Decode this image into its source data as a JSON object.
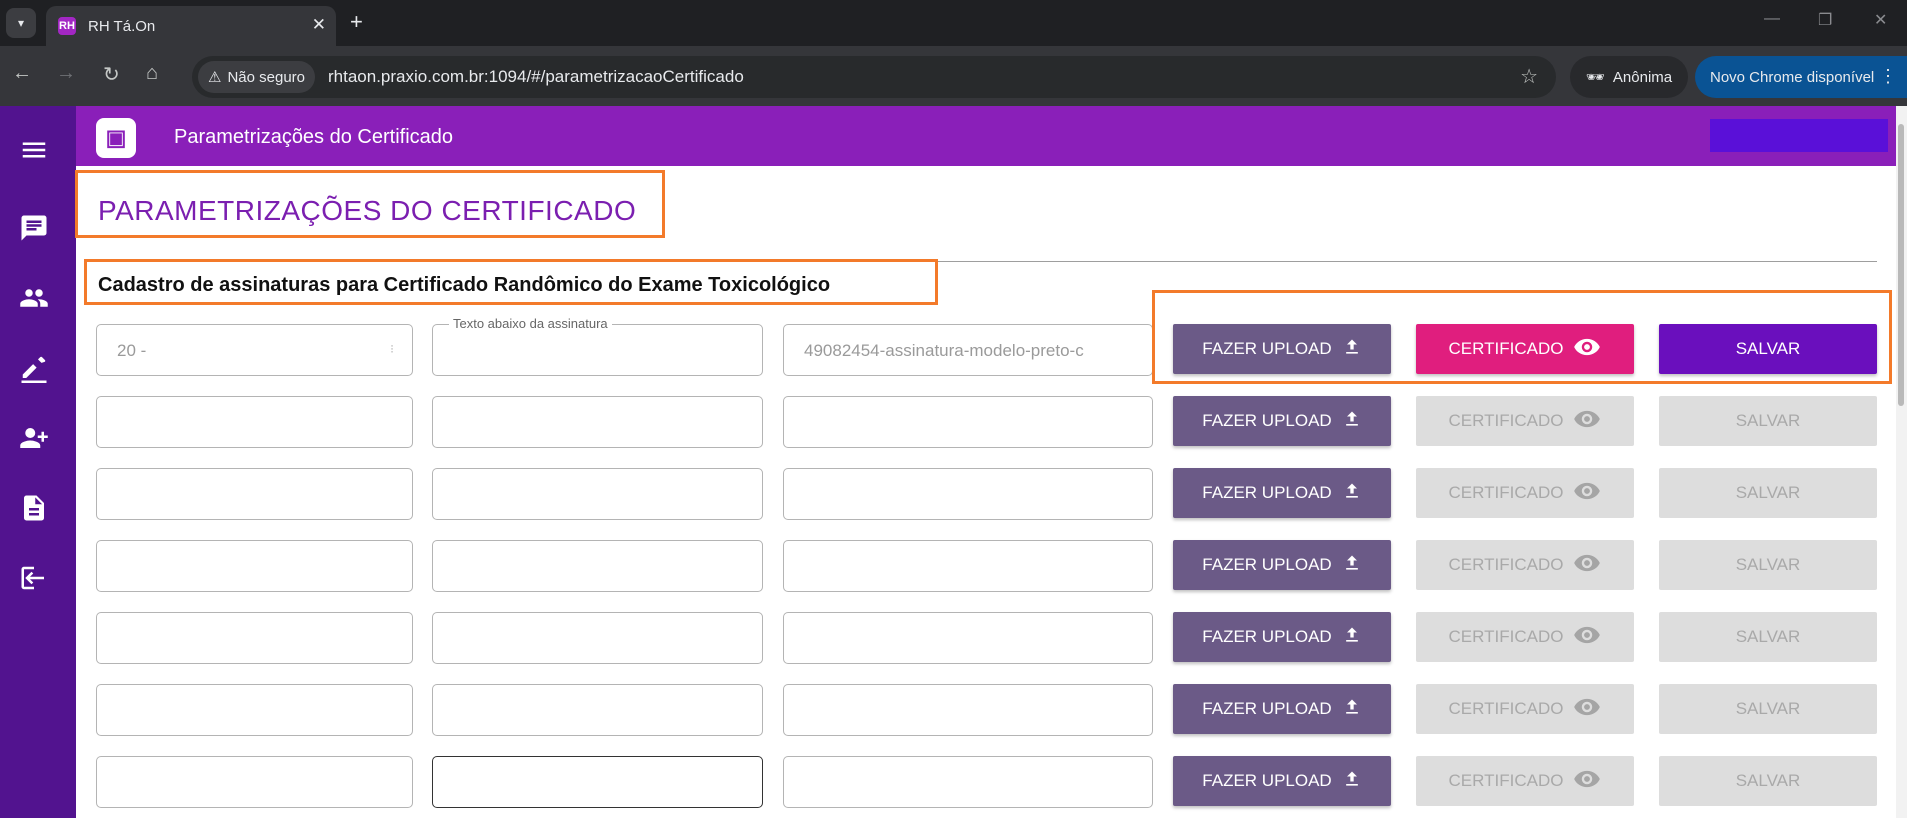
{
  "browser": {
    "tab_title": "RH Tá.On",
    "tab_favicon": "RH",
    "secure_label": "Não seguro",
    "url": "rhtaon.praxio.com.br:1094/#/parametrizacaoCertificado",
    "incognito_label": "Anônima",
    "update_label": "Novo Chrome disponível"
  },
  "app": {
    "header_title": "Parametrizações do Certificado",
    "page_title": "PARAMETRIZAÇÕES DO CERTIFICADO",
    "section_title": "Cadastro de assinaturas para Certificado Randômico do Exame Toxicológico",
    "sidebar_icons": [
      "menu-icon",
      "chat-icon",
      "group-icon",
      "edit-icon",
      "person-add-icon",
      "document-icon",
      "logout-icon"
    ],
    "colors": {
      "sidebar": "#52138f",
      "header": "#8a1fb9",
      "upload": "#6b5a87",
      "certificate": "#e01e7e",
      "save": "#6a0fbd",
      "highlight": "#f37a2a"
    }
  },
  "form": {
    "second_field_label": "Texto abaixo da assinatura",
    "upload_label": "FAZER UPLOAD",
    "certificate_label": "CERTIFICADO",
    "save_label": "SALVAR",
    "rows": [
      {
        "field1": "20 -",
        "field2": "",
        "field3": "49082454-assinatura-modelo-preto-c",
        "enabled": true
      },
      {
        "field1": "",
        "field2": "",
        "field3": "",
        "enabled": false
      },
      {
        "field1": "",
        "field2": "",
        "field3": "",
        "enabled": false
      },
      {
        "field1": "",
        "field2": "",
        "field3": "",
        "enabled": false
      },
      {
        "field1": "",
        "field2": "",
        "field3": "",
        "enabled": false
      },
      {
        "field1": "",
        "field2": "",
        "field3": "",
        "enabled": false
      },
      {
        "field1": "",
        "field2": "",
        "field3": "",
        "enabled": false
      }
    ]
  }
}
